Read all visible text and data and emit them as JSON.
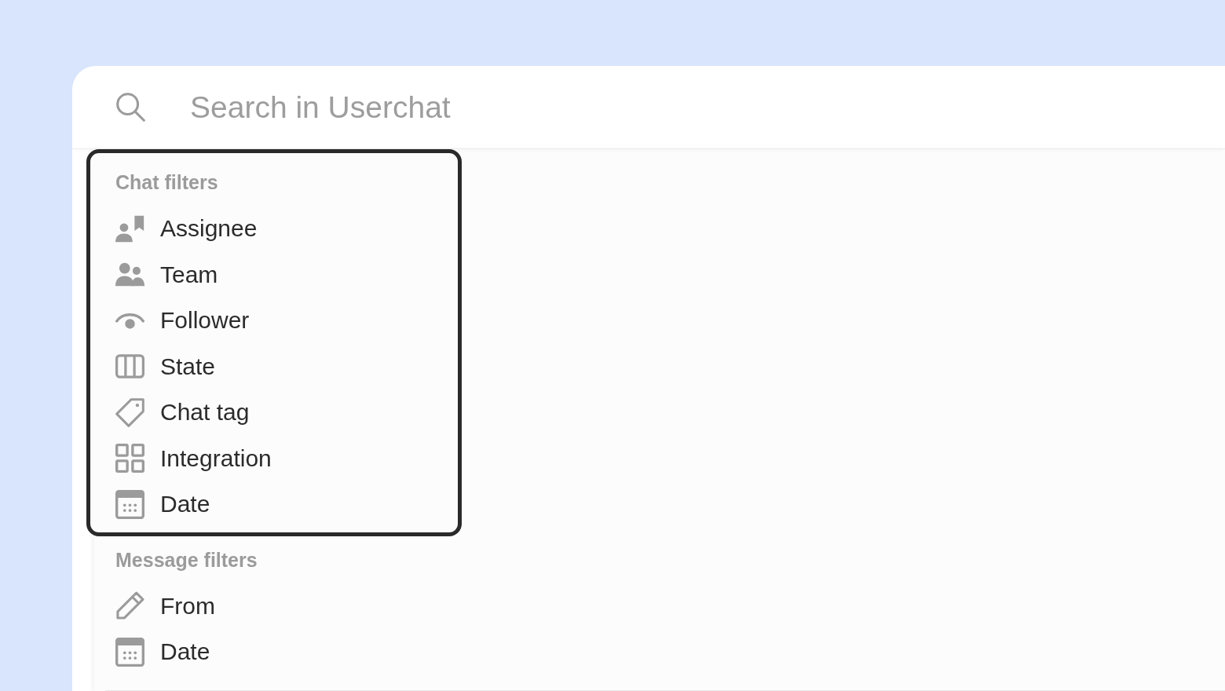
{
  "search": {
    "placeholder": "Search in Userchat"
  },
  "filter_groups": [
    {
      "title": "Chat filters",
      "highlighted": true,
      "items": [
        {
          "label": "Assignee"
        },
        {
          "label": "Team"
        },
        {
          "label": "Follower"
        },
        {
          "label": "State"
        },
        {
          "label": "Chat tag"
        },
        {
          "label": "Integration"
        },
        {
          "label": "Date"
        }
      ]
    },
    {
      "title": "Message filters",
      "highlighted": false,
      "items": [
        {
          "label": "From"
        },
        {
          "label": "Date"
        }
      ]
    }
  ]
}
